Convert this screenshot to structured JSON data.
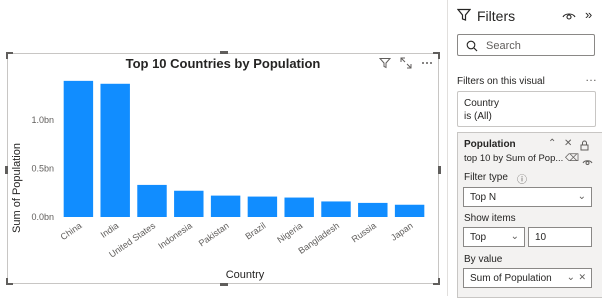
{
  "chart_data": {
    "type": "bar",
    "title": "Top 10 Countries by Population",
    "xlabel": "Country",
    "ylabel": "Sum of Population",
    "categories": [
      "China",
      "India",
      "United States",
      "Indonesia",
      "Pakistan",
      "Brazil",
      "Nigeria",
      "Bangladesh",
      "Russia",
      "Japan"
    ],
    "values": [
      1.4,
      1.37,
      0.33,
      0.27,
      0.22,
      0.21,
      0.2,
      0.16,
      0.145,
      0.126
    ],
    "ylim": [
      0,
      1.45
    ],
    "yticks": [
      0,
      0.5,
      1.0
    ],
    "ytick_labels": [
      "0.0bn",
      "0.5bn",
      "1.0bn"
    ],
    "bar_color": "#118dff",
    "grid": false
  },
  "pane": {
    "title": "Filters",
    "search_placeholder": "Search",
    "section": "Filters on this visual",
    "card1": {
      "field": "Country",
      "state": "is (All)"
    },
    "card2": {
      "field": "Population",
      "summary": "top 10 by Sum of Pop...",
      "filter_type_label": "Filter type",
      "filter_type_value": "Top N",
      "show_items_label": "Show items",
      "show_items_direction": "Top",
      "show_items_count": "10",
      "by_value_label": "By value",
      "by_value_field": "Sum of Population"
    }
  },
  "icons": {
    "funnel": "funnel-icon",
    "eye": "eye-icon",
    "collapse": "double-chevron-right-icon",
    "search": "search-icon",
    "filter": "filter-icon",
    "focus": "focus-mode-icon",
    "more": "more-options-icon"
  }
}
